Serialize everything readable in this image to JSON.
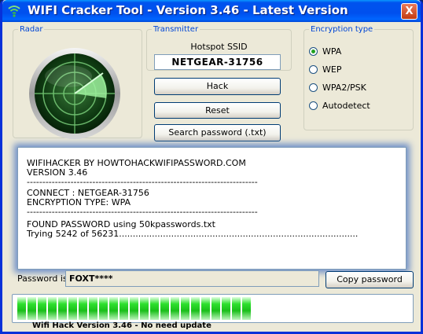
{
  "window": {
    "title": "WIFI Cracker Tool - Version 3.46 - Latest Version",
    "close_label": "X",
    "icon": "wifi-signal-icon"
  },
  "radar": {
    "legend": "Radar",
    "icon": "radar-icon"
  },
  "transmitter": {
    "legend": "Transmitter",
    "ssid_label": "Hotspot SSID",
    "ssid_value": "NETGEAR-31756"
  },
  "buttons": {
    "hack": "Hack",
    "reset": "Reset",
    "search_password": "Search password (.txt)",
    "copy_password": "Copy password"
  },
  "encryption": {
    "legend": "Encryption type",
    "options": [
      {
        "label": "WPA",
        "checked": true
      },
      {
        "label": "WEP",
        "checked": false
      },
      {
        "label": "WPA2/PSK",
        "checked": false
      },
      {
        "label": "Autodetect",
        "checked": false
      }
    ]
  },
  "log": {
    "lines": [
      "WIFIHACKER BY HOWTOHACKWIFIPASSWORD.COM",
      "VERSION 3.46",
      "--------------------------------------------------------------------------",
      "CONNECT : NETGEAR-31756",
      "ENCRYPTION TYPE: WPA",
      "--------------------------------------------------------------------------",
      "FOUND PASSWORD using 50kpasswords.txt",
      "Trying 5242 of 56231......................................................................................."
    ]
  },
  "password": {
    "label": "Password is:",
    "value": "FOXT****"
  },
  "progress": {
    "fraction": 0.6
  },
  "status": {
    "text": "Wifi Hack Version 3.46 - No need update"
  },
  "colors": {
    "title_bar": "#0053ee",
    "close_button": "#c23c12",
    "progress_green": "#1abf1a",
    "log_glow": "#6e8fc8",
    "legend_blue": "#0046d5"
  }
}
